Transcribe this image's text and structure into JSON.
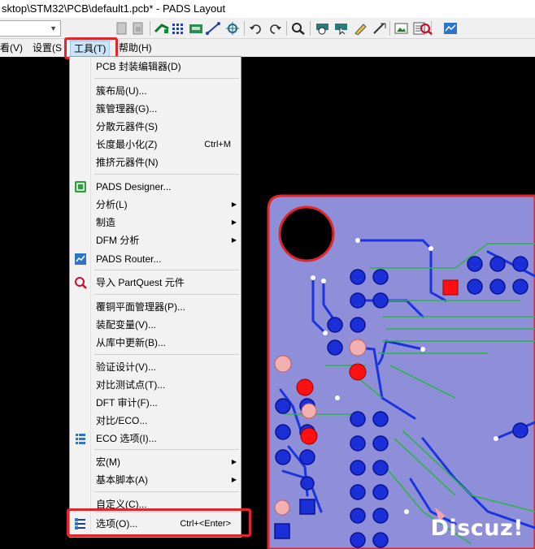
{
  "window": {
    "title": "sktop\\STM32\\PCB\\default1.pcb* - PADS Layout"
  },
  "toolbar": {
    "icons": [
      "find-icon",
      "refresh-icon",
      "page-icon",
      "page-copy-icon",
      "route-icon",
      "pads-grid-icon",
      "layer-icon",
      "wire-icon",
      "via-icon",
      "undo-icon",
      "redo-icon",
      "zoom-icon",
      "select-filter-icon",
      "select-icon",
      "highlight-icon",
      "draw-icon",
      "image-icon",
      "properties-icon",
      "partquest-icon",
      "router-icon"
    ]
  },
  "menubar": {
    "view": "看(V)",
    "setup": "设置(S",
    "tools": "工具(T)",
    "help": "帮助(H)"
  },
  "tools_menu": {
    "items": [
      {
        "label": "PCB 封装编辑器(D)",
        "shortcut": ""
      },
      {
        "label": "簇布局(U)...",
        "shortcut": ""
      },
      {
        "label": "簇管理器(G)...",
        "shortcut": ""
      },
      {
        "label": "分散元器件(S)",
        "shortcut": ""
      },
      {
        "label": "长度最小化(Z)",
        "shortcut": "Ctrl+M"
      },
      {
        "label": "推挤元器件(N)",
        "shortcut": ""
      },
      {
        "label": "PADS Designer...",
        "shortcut": ""
      },
      {
        "label": "分析(L)",
        "shortcut": ""
      },
      {
        "label": "制造",
        "shortcut": ""
      },
      {
        "label": "DFM 分析",
        "shortcut": ""
      },
      {
        "label": "PADS Router...",
        "shortcut": ""
      },
      {
        "label": "导入 PartQuest 元件",
        "shortcut": ""
      },
      {
        "label": "覆铜平面管理器(P)...",
        "shortcut": ""
      },
      {
        "label": "装配变量(V)...",
        "shortcut": ""
      },
      {
        "label": "从库中更新(B)...",
        "shortcut": ""
      },
      {
        "label": "验证设计(V)...",
        "shortcut": ""
      },
      {
        "label": "对比测试点(T)...",
        "shortcut": ""
      },
      {
        "label": "DFT 审计(F)...",
        "shortcut": ""
      },
      {
        "label": "对比/ECO...",
        "shortcut": ""
      },
      {
        "label": "ECO 选项(I)...",
        "shortcut": ""
      },
      {
        "label": "宏(M)",
        "shortcut": ""
      },
      {
        "label": "基本脚本(A)",
        "shortcut": ""
      },
      {
        "label": "自定义(C)...",
        "shortcut": ""
      },
      {
        "label": "选项(O)...",
        "shortcut": "Ctrl+<Enter>"
      }
    ]
  },
  "watermark": "Discuz!",
  "colors": {
    "board": "#8f8fd9",
    "outline": "#e0262a",
    "trace": "#1a35e0",
    "pad": "#1a2fd8",
    "menu_bg": "#f2f2f2"
  }
}
